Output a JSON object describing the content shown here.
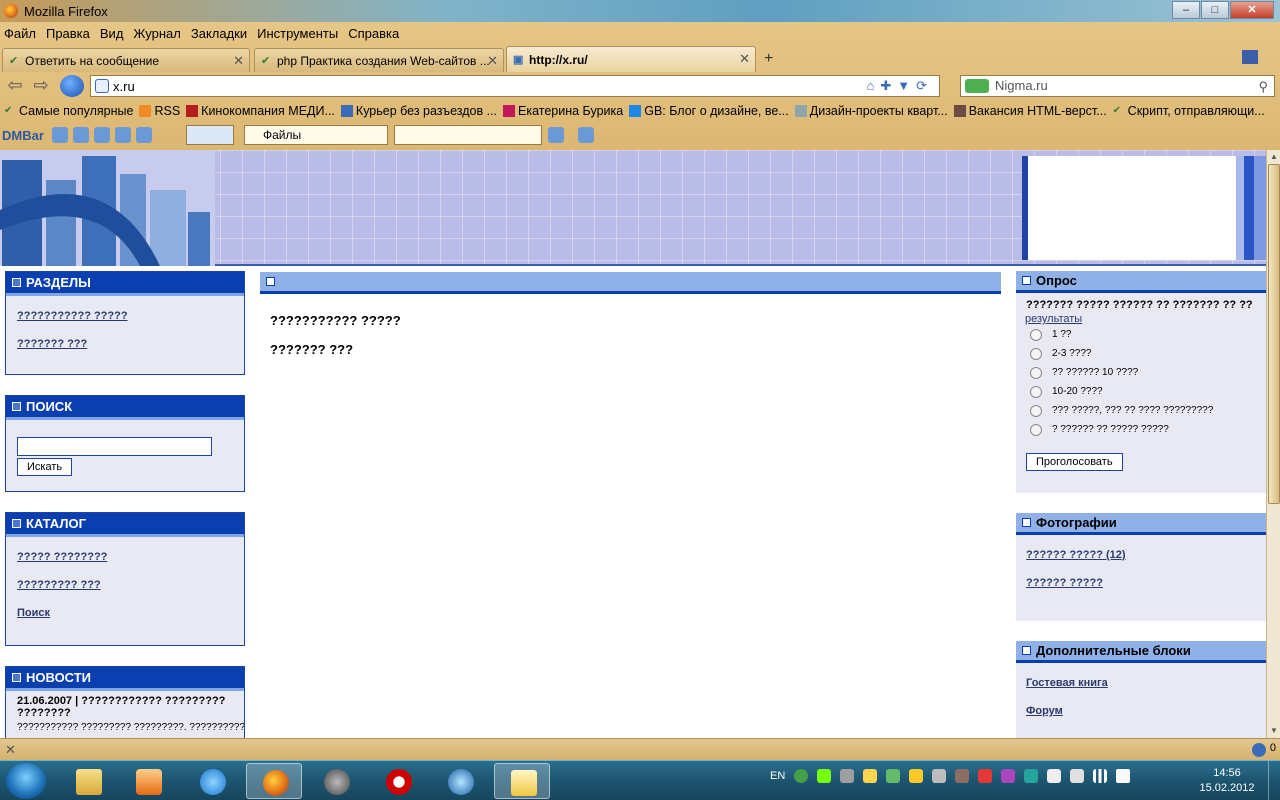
{
  "window": {
    "title": "Mozilla Firefox",
    "buttons": {
      "minimize": "–",
      "maximize": "□",
      "close": "✕"
    }
  },
  "menu": [
    "Файл",
    "Правка",
    "Вид",
    "Журнал",
    "Закладки",
    "Инструменты",
    "Справка"
  ],
  "tabs": [
    {
      "label": "Ответить на сообщение",
      "active": false
    },
    {
      "label": "php Практика создания Web-сайтов ...",
      "active": false
    },
    {
      "label": "http://x.ru/",
      "active": true
    }
  ],
  "new_tab": "+",
  "nav": {
    "url": "x.ru",
    "search_engine_text": "Nigma.ru"
  },
  "bookmarks": [
    "Самые популярные",
    "RSS",
    "Кинокомпания МЕДИ...",
    "Курьер без разъездов ...",
    "Екатерина Бурика",
    "GB: Блог о дизайне, ве...",
    "Дизайн-проекты кварт...",
    "Вакансия HTML-верст...",
    "Скрипт, отправляющи..."
  ],
  "dmbar": {
    "logo": "DMBar",
    "files_label": "Файлы"
  },
  "left": {
    "sections": {
      "title": "РАЗДЕЛЫ",
      "links": [
        "??????????? ?????",
        "??????? ???"
      ]
    },
    "search": {
      "title": "ПОИСК",
      "button": "Искать",
      "value": ""
    },
    "catalog": {
      "title": "КАТАЛОГ",
      "links": [
        "????? ????????",
        "????????? ???",
        "Поиск"
      ]
    },
    "news": {
      "title": "НОВОСТИ",
      "date_line": "21.06.2007 | ???????????? ?????????",
      "date_line2": "????????",
      "text": "??????????? ????????? ?????????. ???????????"
    }
  },
  "center": {
    "lines": [
      "??????????? ?????",
      "??????? ???"
    ]
  },
  "right": {
    "poll": {
      "title": "Опрос",
      "question": "??????? ????? ?????? ?? ??????? ?? ??",
      "results_link": "результаты",
      "options": [
        "1 ??",
        "2-3 ????",
        "?? ?????? 10 ????",
        "10-20 ????",
        "??? ?????, ??? ?? ???? ?????????",
        "? ?????? ?? ????? ?????"
      ],
      "vote_button": "Проголосовать"
    },
    "photos": {
      "title": "Фотографии",
      "links": [
        "?????? ????? (12)",
        "?????? ?????"
      ]
    },
    "extra": {
      "title": "Дополнительные блоки",
      "links": [
        "Гостевая книга",
        "Форум"
      ]
    }
  },
  "status": {
    "count": "0"
  },
  "taskbar": {
    "lang": "EN",
    "time": "14:56",
    "date": "15.02.2012"
  }
}
